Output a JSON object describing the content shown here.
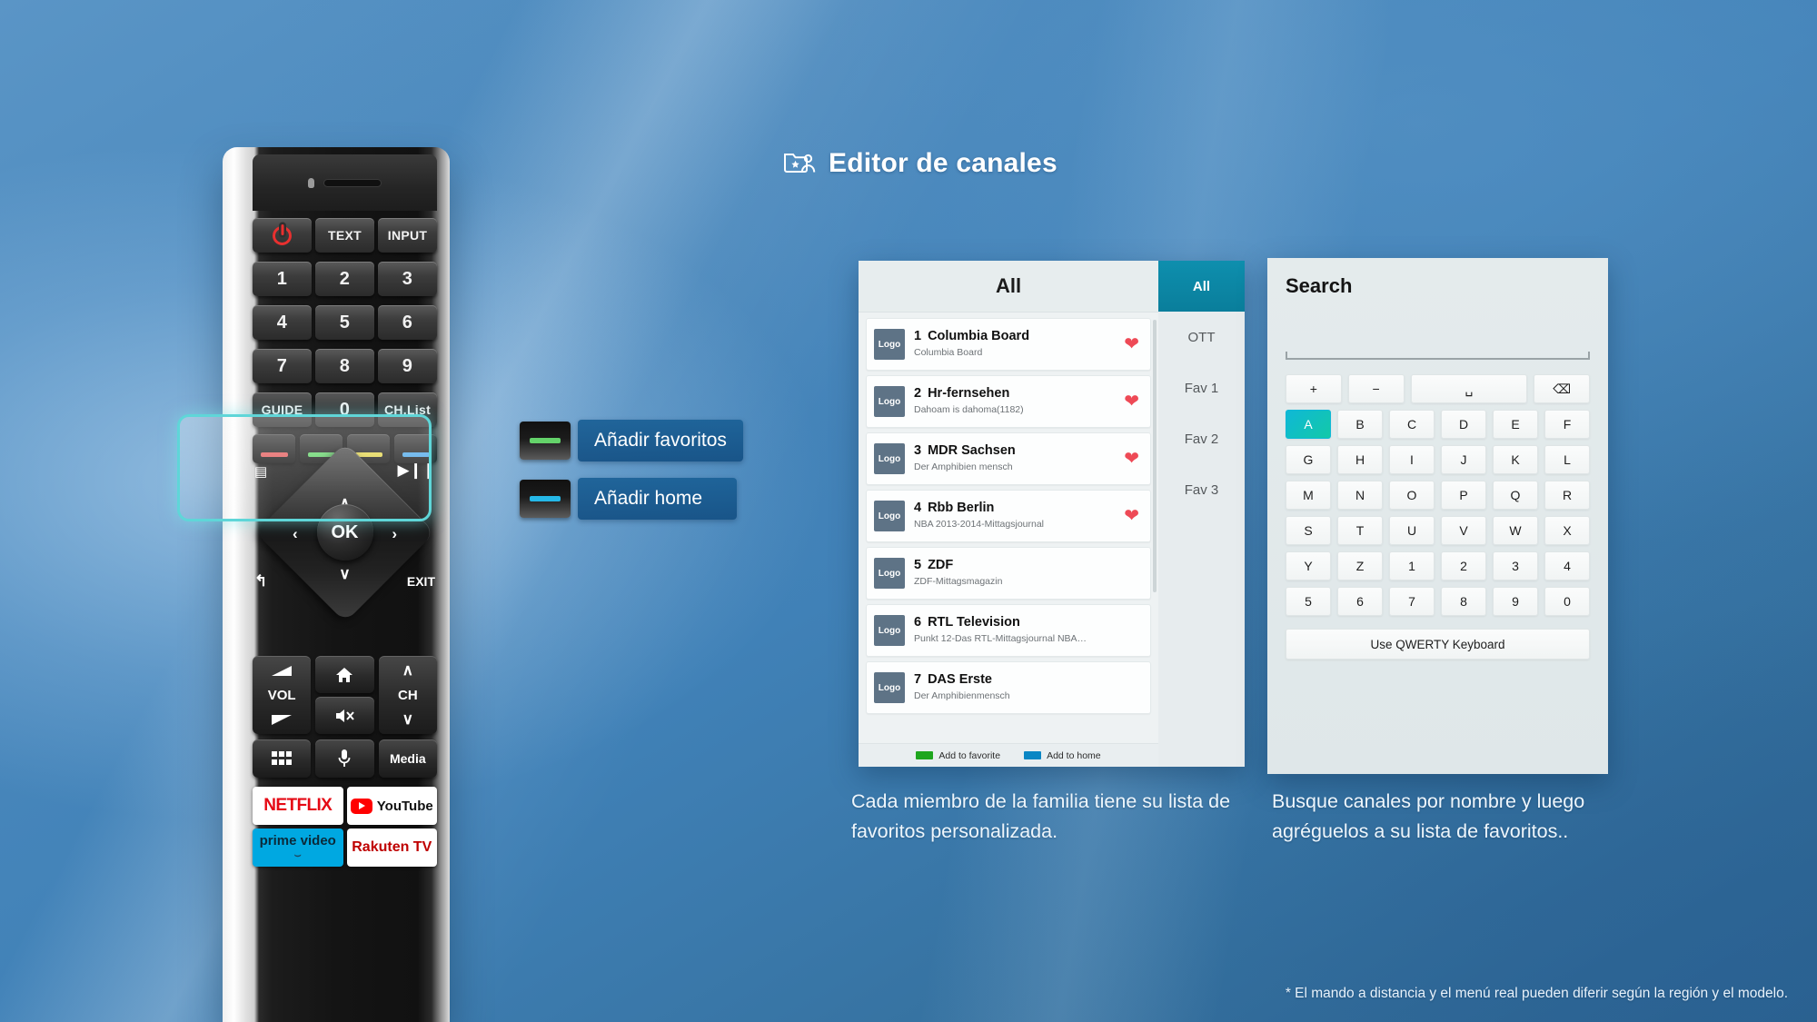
{
  "title": {
    "text": "Editor de canales",
    "icon": "folder-star-person-icon"
  },
  "colors": {
    "accent_teal": "#0e8fae",
    "highlight_cyan": "#5fd6d8",
    "heart_red": "#ee4a56",
    "green_key": "#1ea61e",
    "blue_key": "#0a86c4",
    "key_selected_gradient_start": "#0fb8d6",
    "key_selected_gradient_end": "#13c9a8"
  },
  "remote": {
    "row_power": [
      {
        "label": "",
        "icon": "power-icon"
      },
      {
        "label": "TEXT"
      },
      {
        "label": "INPUT"
      }
    ],
    "numpad": [
      "1",
      "2",
      "3",
      "4",
      "5",
      "6",
      "7",
      "8",
      "9"
    ],
    "row_guide": [
      "GUIDE",
      "0",
      "CH.List"
    ],
    "color_buttons": [
      {
        "name": "red-color-button",
        "color": "#e35d5d"
      },
      {
        "name": "green-color-button",
        "color": "#64d36a"
      },
      {
        "name": "yellow-color-button",
        "color": "#e2d44e"
      },
      {
        "name": "blue-color-button",
        "color": "#4fa8e8"
      }
    ],
    "menu_icon": "menu-list-icon",
    "playpause_icon": "play-pause-icon",
    "ok_label": "OK",
    "back_icon": "back-arrow-icon",
    "exit_label": "EXIT",
    "vol_label": "VOL",
    "home_icon": "home-icon",
    "mute_icon": "mute-icon",
    "ch_label": "CH",
    "apps_icon": "apps-grid-icon",
    "mic_icon": "microphone-icon",
    "media_label": "Media",
    "apps": [
      {
        "name": "netflix-button",
        "label": "NETFLIX"
      },
      {
        "name": "youtube-button",
        "label": "YouTube"
      },
      {
        "name": "prime-video-button",
        "label": "prime video"
      },
      {
        "name": "rakuten-tv-button",
        "label": "Rakuten TV"
      }
    ]
  },
  "callouts": [
    {
      "label": "Añadir favoritos",
      "swatch_color": "#64d36a"
    },
    {
      "label": "Añadir home",
      "swatch_color": "#25b8e8"
    }
  ],
  "channel_panel": {
    "header": "All",
    "scroll_visible": true,
    "items": [
      {
        "number": "1",
        "name": "Columbia Board",
        "program": "Columbia Board",
        "logo": "Logo",
        "favorite": true
      },
      {
        "number": "2",
        "name": "Hr-fernsehen",
        "program": "Dahoam is dahoma(1182)",
        "logo": "Logo",
        "favorite": true
      },
      {
        "number": "3",
        "name": "MDR Sachsen",
        "program": "Der Amphibien mensch",
        "logo": "Logo",
        "favorite": true
      },
      {
        "number": "4",
        "name": "Rbb Berlin",
        "program": "NBA 2013-2014-Mittagsjournal",
        "logo": "Logo",
        "favorite": true
      },
      {
        "number": "5",
        "name": "ZDF",
        "program": "ZDF-Mittagsmagazin",
        "logo": "Logo",
        "favorite": false
      },
      {
        "number": "6",
        "name": "RTL Television",
        "program": "Punkt 12-Das RTL-Mittagsjournal NBA…",
        "logo": "Logo",
        "favorite": false
      },
      {
        "number": "7",
        "name": "DAS Erste",
        "program": "Der Amphibienmensch",
        "logo": "Logo",
        "favorite": false
      }
    ],
    "tabs": [
      {
        "label": "All",
        "active": true
      },
      {
        "label": "OTT",
        "active": false
      },
      {
        "label": "Fav 1",
        "active": false
      },
      {
        "label": "Fav 2",
        "active": false
      },
      {
        "label": "Fav 3",
        "active": false
      }
    ],
    "footer": [
      {
        "label": "Add to favorite",
        "color": "#1ea61e"
      },
      {
        "label": "Add to home",
        "color": "#0a86c4"
      }
    ]
  },
  "search_panel": {
    "title": "Search",
    "input_value": "",
    "input_placeholder": "",
    "keyboard": {
      "row_symbols": [
        {
          "label": "+",
          "name": "plus-key"
        },
        {
          "label": "−",
          "name": "minus-key"
        },
        {
          "label": "␣",
          "name": "space-key",
          "wide": true
        },
        {
          "label": "⌫",
          "name": "backspace-key"
        }
      ],
      "rows": [
        [
          "A",
          "B",
          "C",
          "D",
          "E",
          "F"
        ],
        [
          "G",
          "H",
          "I",
          "J",
          "K",
          "L"
        ],
        [
          "M",
          "N",
          "O",
          "P",
          "Q",
          "R"
        ],
        [
          "S",
          "T",
          "U",
          "V",
          "W",
          "X"
        ],
        [
          "Y",
          "Z",
          "1",
          "2",
          "3",
          "4"
        ],
        [
          "5",
          "6",
          "7",
          "8",
          "9",
          "0"
        ]
      ],
      "selected_key": "A",
      "qwerty_button": "Use QWERTY Keyboard"
    }
  },
  "captions": {
    "left": "Cada miembro de la familia tiene su lista de favoritos personalizada.",
    "right": "Busque canales por nombre y luego agréguelos a su lista de favoritos.."
  },
  "disclaimer": "* El mando a distancia y el menú real pueden diferir según la región y el modelo."
}
